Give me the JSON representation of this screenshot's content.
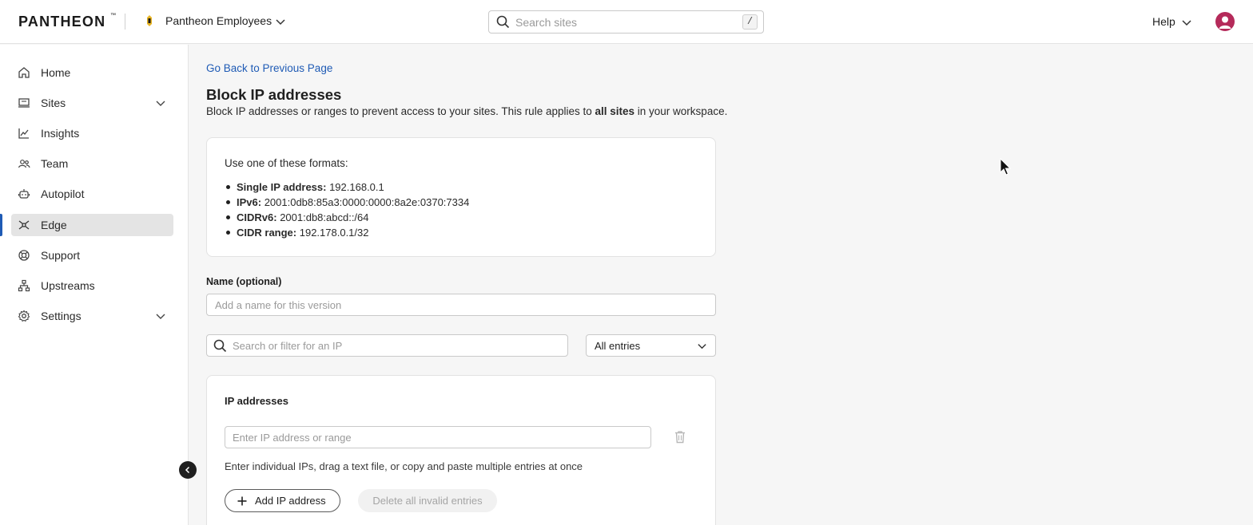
{
  "header": {
    "logo": "PANTHEON",
    "logo_tm": "™",
    "workspace_name": "Pantheon Employees",
    "search_placeholder": "Search sites",
    "search_shortcut": "/",
    "help_label": "Help"
  },
  "sidebar": {
    "items": [
      {
        "label": "Home",
        "icon": "home-icon"
      },
      {
        "label": "Sites",
        "icon": "sites-icon",
        "expandable": true
      },
      {
        "label": "Insights",
        "icon": "chart-line-icon"
      },
      {
        "label": "Team",
        "icon": "team-icon"
      },
      {
        "label": "Autopilot",
        "icon": "robot-icon"
      },
      {
        "label": "Edge",
        "icon": "edge-icon",
        "active": true
      },
      {
        "label": "Support",
        "icon": "lifebuoy-icon"
      },
      {
        "label": "Upstreams",
        "icon": "hierarchy-icon"
      },
      {
        "label": "Settings",
        "icon": "gear-icon",
        "expandable": true
      }
    ]
  },
  "main": {
    "back_link": "Go Back to Previous Page",
    "title": "Block IP addresses",
    "description_pre": "Block IP addresses or ranges to prevent access to your sites. This rule applies to ",
    "description_bold": "all sites",
    "description_post": " in your workspace.",
    "formats": {
      "intro": "Use one of these formats:",
      "items": [
        {
          "label": "Single IP address:",
          "value": " 192.168.0.1"
        },
        {
          "label": "IPv6:",
          "value": " 2001:0db8:85a3:0000:0000:8a2e:0370:7334"
        },
        {
          "label": "CIDRv6:",
          "value": " 2001:db8:abcd::/64"
        },
        {
          "label": "CIDR range:",
          "value": " 192.178.0.1/32"
        }
      ]
    },
    "name_field": {
      "label": "Name (optional)",
      "placeholder": "Add a name for this version",
      "value": ""
    },
    "filter": {
      "placeholder": "Search or filter for an IP",
      "select_value": "All entries"
    },
    "ip_card": {
      "title": "IP addresses",
      "input_placeholder": "Enter IP address or range",
      "hint": "Enter individual IPs, drag a text file, or copy and paste multiple entries at once",
      "add_button": "Add IP address",
      "delete_button": "Delete all invalid entries"
    }
  },
  "colors": {
    "accent": "#1f5bb5",
    "avatar": "#b52a5a",
    "active_nav_bg": "#e4e4e4"
  }
}
